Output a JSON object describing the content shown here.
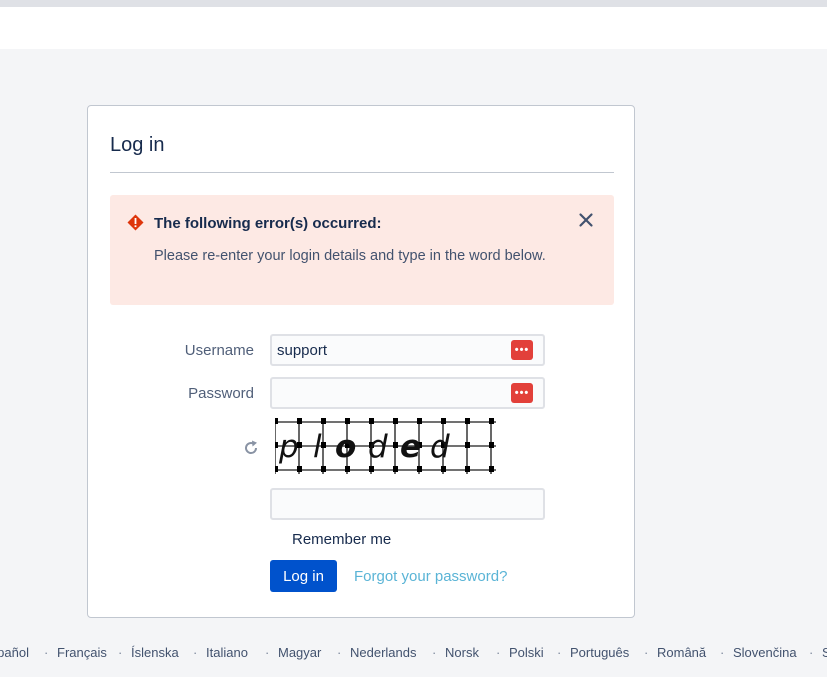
{
  "login_card": {
    "title": "Log in",
    "error": {
      "title": "The following error(s) occurred:",
      "message": "Please re-enter your login details and type in the word below."
    },
    "username": {
      "label": "Username",
      "value": "support"
    },
    "password": {
      "label": "Password",
      "value": ""
    },
    "captcha": {
      "word": "ploded",
      "answer": ""
    },
    "remember_me": "Remember me",
    "login_button": "Log in",
    "forgot_link": "Forgot your password?"
  },
  "footer": {
    "languages": [
      "Español",
      "Français",
      "Íslenska",
      "Italiano",
      "Magyar",
      "Nederlands",
      "Norsk",
      "Polski",
      "Português",
      "Română",
      "Slovenčina",
      "Suomi"
    ]
  },
  "colors": {
    "primary_button": "#0052cc",
    "error_background": "#fde9e4",
    "error_icon": "#de350b",
    "link": "#5ab4d6",
    "password_manager_badge": "#e2403a"
  }
}
